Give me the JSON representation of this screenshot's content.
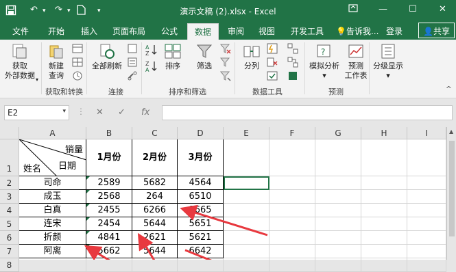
{
  "window": {
    "title": "演示文稿 (2).xlsx - Excel"
  },
  "ribbon_tabs": [
    {
      "label": "文件",
      "active": false
    },
    {
      "label": "开始",
      "active": false
    },
    {
      "label": "插入",
      "active": false
    },
    {
      "label": "页面布局",
      "active": false
    },
    {
      "label": "公式",
      "active": false
    },
    {
      "label": "数据",
      "active": true
    },
    {
      "label": "审阅",
      "active": false
    },
    {
      "label": "视图",
      "active": false
    },
    {
      "label": "开发工具",
      "active": false
    }
  ],
  "tell_me": "告诉我...",
  "login": "登录",
  "share": "共享",
  "ribbon": {
    "get_data_line1": "获取",
    "get_data_line2": "外部数据",
    "new_query_line1": "新建",
    "new_query_line2": "查询",
    "refresh_all": "全部刷新",
    "sort": "排序",
    "filter": "筛选",
    "text_to_columns": "分列",
    "whatif_line1": "模拟分析",
    "forecast_line1": "预测",
    "forecast_line2": "工作表",
    "outline": "分级显示",
    "groups": {
      "get_transform": "获取和转换",
      "connections": "连接",
      "sort_filter": "排序和筛选",
      "data_tools": "数据工具",
      "forecast": "预测"
    }
  },
  "formula_bar": {
    "name_box": "E2",
    "fx": "fx",
    "formula": ""
  },
  "grid": {
    "columns": [
      "A",
      "B",
      "C",
      "D",
      "E",
      "F",
      "G",
      "H",
      "I"
    ],
    "rows": [
      "1",
      "2",
      "3",
      "4",
      "5",
      "6",
      "7",
      "8"
    ],
    "header": {
      "top_right": "销量",
      "mid_right": "日期",
      "bottom_left": "姓名",
      "b": "1月份",
      "c": "2月份",
      "d": "3月份"
    },
    "data": [
      [
        "司命",
        "2589",
        "5682",
        "4564"
      ],
      [
        "成玉",
        "2568",
        "264",
        "6510"
      ],
      [
        "白真",
        "2455",
        "6266",
        "1665"
      ],
      [
        "连宋",
        "2454",
        "5644",
        "5651"
      ],
      [
        "折颜",
        "4841",
        "2621",
        "5621"
      ],
      [
        "阿离",
        "5662",
        "5644",
        "6642"
      ],
      [
        "",
        "",
        "",
        ""
      ]
    ]
  },
  "colors": {
    "excel_green": "#217346",
    "annotation_red": "#e8393f"
  }
}
